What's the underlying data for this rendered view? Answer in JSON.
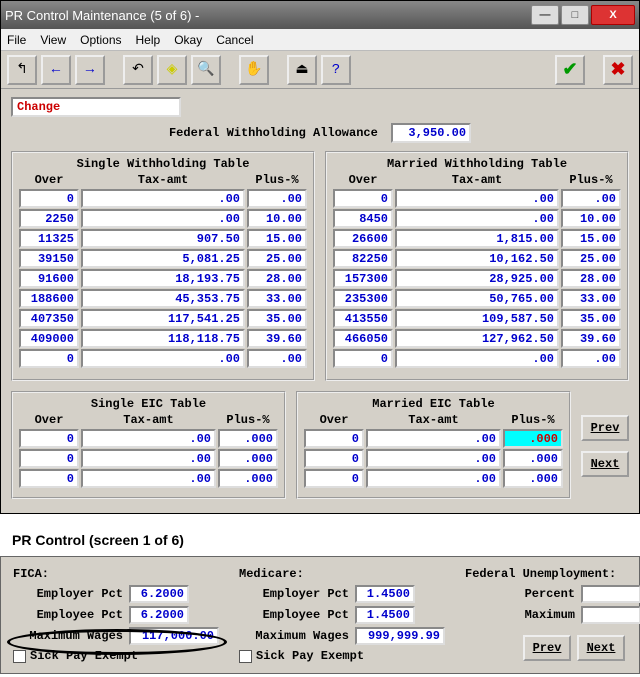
{
  "window": {
    "title": "PR Control Maintenance (5 of 6) -",
    "buttons": {
      "min": "—",
      "max": "□",
      "close": "X"
    }
  },
  "menu": [
    "File",
    "View",
    "Options",
    "Help",
    "Okay",
    "Cancel"
  ],
  "toolbar_icons": {
    "exit": "↰",
    "back": "←",
    "fwd": "→",
    "undo": "↶",
    "diamond": "◈",
    "find": "🔍",
    "hand": "✋",
    "eject": "⏏",
    "help": "?",
    "check": "✔",
    "cancel": "✖"
  },
  "change_label": "Change",
  "federal": {
    "label": "Federal Withholding Allowance",
    "value": "3,950.00"
  },
  "single": {
    "title": "Single Withholding Table",
    "headers": [
      "Over",
      "Tax-amt",
      "Plus-%"
    ],
    "rows": [
      [
        "0",
        ".00",
        ".00"
      ],
      [
        "2250",
        ".00",
        "10.00"
      ],
      [
        "11325",
        "907.50",
        "15.00"
      ],
      [
        "39150",
        "5,081.25",
        "25.00"
      ],
      [
        "91600",
        "18,193.75",
        "28.00"
      ],
      [
        "188600",
        "45,353.75",
        "33.00"
      ],
      [
        "407350",
        "117,541.25",
        "35.00"
      ],
      [
        "409000",
        "118,118.75",
        "39.60"
      ],
      [
        "0",
        ".00",
        ".00"
      ]
    ]
  },
  "married": {
    "title": "Married Withholding Table",
    "headers": [
      "Over",
      "Tax-amt",
      "Plus-%"
    ],
    "rows": [
      [
        "0",
        ".00",
        ".00"
      ],
      [
        "8450",
        ".00",
        "10.00"
      ],
      [
        "26600",
        "1,815.00",
        "15.00"
      ],
      [
        "82250",
        "10,162.50",
        "25.00"
      ],
      [
        "157300",
        "28,925.00",
        "28.00"
      ],
      [
        "235300",
        "50,765.00",
        "33.00"
      ],
      [
        "413550",
        "109,587.50",
        "35.00"
      ],
      [
        "466050",
        "127,962.50",
        "39.60"
      ],
      [
        "0",
        ".00",
        ".00"
      ]
    ]
  },
  "single_eic": {
    "title": "Single EIC Table",
    "headers": [
      "Over",
      "Tax-amt",
      "Plus-%"
    ],
    "rows": [
      [
        "0",
        ".00",
        ".000"
      ],
      [
        "0",
        ".00",
        ".000"
      ],
      [
        "0",
        ".00",
        ".000"
      ]
    ]
  },
  "married_eic": {
    "title": "Married EIC Table",
    "headers": [
      "Over",
      "Tax-amt",
      "Plus-%"
    ],
    "rows": [
      [
        "0",
        ".00",
        ".000"
      ],
      [
        "0",
        ".00",
        ".000"
      ],
      [
        "0",
        ".00",
        ".000"
      ]
    ],
    "highlight": {
      "row": 0,
      "col": 2
    }
  },
  "nav": {
    "prev": "Prev",
    "next": "Next"
  },
  "caption2": "PR Control (screen 1 of 6)",
  "fica": {
    "title": "FICA:",
    "employer_lbl": "Employer Pct",
    "employer": "6.2000",
    "employee_lbl": "Employee Pct",
    "employee": "6.2000",
    "max_lbl": "Maximum Wages",
    "max": "117,000.00",
    "sick_lbl": "Sick Pay Exempt"
  },
  "medicare": {
    "title": "Medicare:",
    "employer_lbl": "Employer Pct",
    "employer": "1.4500",
    "employee_lbl": "Employee Pct",
    "employee": "1.4500",
    "max_lbl": "Maximum Wages",
    "max": "999,999.99",
    "sick_lbl": "Sick Pay Exempt"
  },
  "fute": {
    "title": "Federal Unemployment:",
    "pct_lbl": "Percent",
    "pct": "",
    "max_lbl": "Maximum",
    "max": ""
  }
}
